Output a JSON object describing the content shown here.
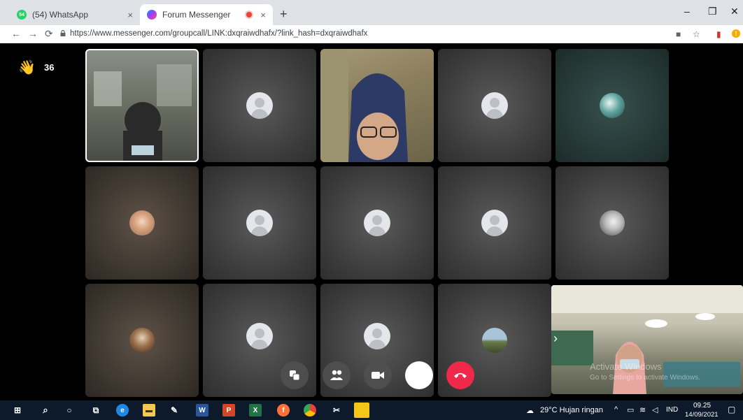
{
  "browser": {
    "tabs": [
      {
        "label": "(54) WhatsApp",
        "badge": "54"
      },
      {
        "label": "Forum Messenger"
      }
    ],
    "url": "https://www.messenger.com/groupcall/LINK:dxqraiwdhafx/?link_hash=dxqraiwdhafx",
    "close_glyph": "×",
    "new_tab_glyph": "+"
  },
  "call": {
    "wave_count": "36",
    "watermark_line1": "Activate Windows",
    "watermark_line2": "Go to Settings to activate Windows."
  },
  "taskbar": {
    "weather": "29°C  Hujan ringan",
    "language": "IND",
    "time": "09.25",
    "date": "14/09/2021"
  },
  "colors": {
    "end_call": "#f02849",
    "messenger": "#a33bf4",
    "whatsapp": "#25d366"
  }
}
